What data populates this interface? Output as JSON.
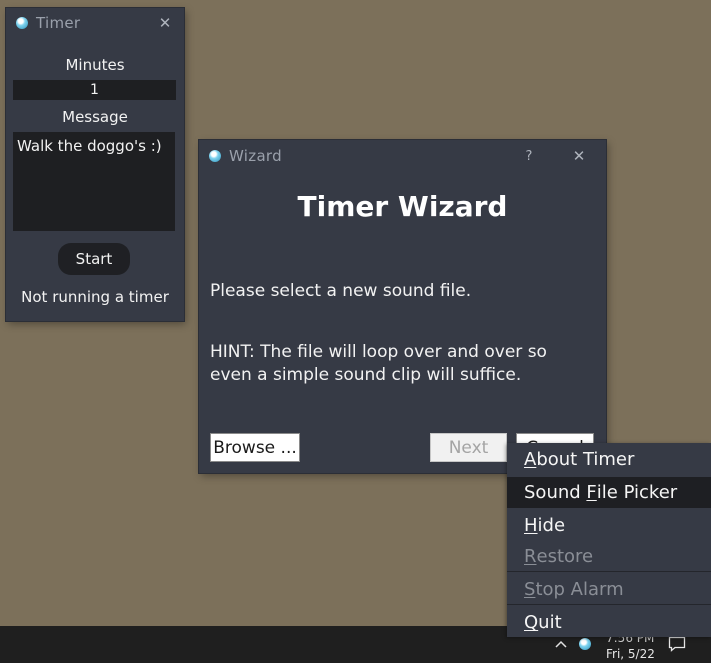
{
  "timer_window": {
    "title": "Timer",
    "close_glyph": "✕",
    "minutes_label": "Minutes",
    "minutes_value": "1",
    "message_label": "Message",
    "message_value": "Walk the doggo's :)",
    "start_label": "Start",
    "status_text": "Not running a timer"
  },
  "wizard": {
    "title_bar": "Wizard",
    "help_glyph": "?",
    "close_glyph": "✕",
    "heading": "Timer Wizard",
    "instruction": "Please select a new sound file.",
    "hint_line1": "HINT:  The file will loop over and over so",
    "hint_line2": "even a simple sound clip will suffice.",
    "browse_label": "Browse ...",
    "next_label": "Next",
    "cancel_label": "Cancel"
  },
  "context_menu": {
    "items": [
      {
        "label": "About Timer",
        "accel": "A",
        "rest": "bout Timer",
        "state": "normal"
      },
      {
        "label": "Sound File Picker",
        "pre": "Sound ",
        "accel": "F",
        "rest": "ile Picker",
        "state": "highlighted"
      },
      {
        "label": "Hide",
        "accel": "H",
        "rest": "ide",
        "state": "normal"
      },
      {
        "label": "Restore",
        "accel": "R",
        "rest": "estore",
        "state": "disabled"
      },
      {
        "label": "Stop Alarm",
        "accel": "S",
        "rest": "top Alarm",
        "state": "disabled"
      },
      {
        "label": "Quit",
        "accel": "Q",
        "rest": "uit",
        "state": "normal"
      }
    ]
  },
  "taskbar": {
    "time": "7:56 PM",
    "date": "Fri, 5/22"
  },
  "icons": {
    "app": "timer-app-icon",
    "tray_chevron": "chevron-up-icon",
    "notifications": "notification-icon"
  },
  "colors": {
    "desktop": "#7c705a",
    "window_bg": "#363a45",
    "field_bg": "#1e1f22"
  }
}
